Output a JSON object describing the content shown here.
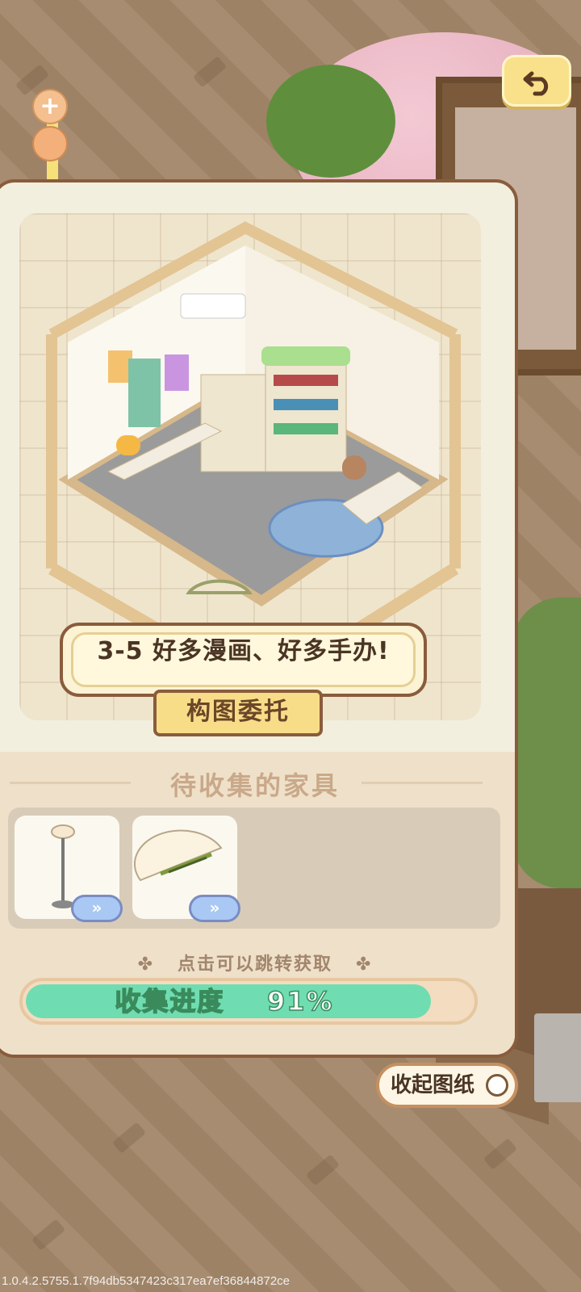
{
  "top": {
    "zoom_plus_symbol": "+",
    "back_icon": "undo-arrow-icon"
  },
  "panel": {
    "level_title": "3-5 好多漫画、好多手办!",
    "ribbon_label": "构图委托",
    "section_title": "待收集的家具",
    "items": [
      {
        "name": "floor-lamp",
        "icon": "floor-lamp-icon",
        "go_label": "»"
      },
      {
        "name": "half-moon-rug",
        "icon": "half-rug-icon",
        "go_label": "»"
      }
    ],
    "hint": "点击可以跳转获取",
    "progress_label": "收集进度",
    "progress_value": "91%",
    "progress_fraction": 0.91
  },
  "collapse_button": "收起图纸",
  "version": "1.0.4.2.5755.1.7f94db5347423c317ea7ef36844872ce",
  "colors": {
    "progress_fill": "#6fddb1",
    "panel_bg": "#f2efdf",
    "border_brown": "#8a5c3c",
    "back_button": "#f9e08a"
  }
}
